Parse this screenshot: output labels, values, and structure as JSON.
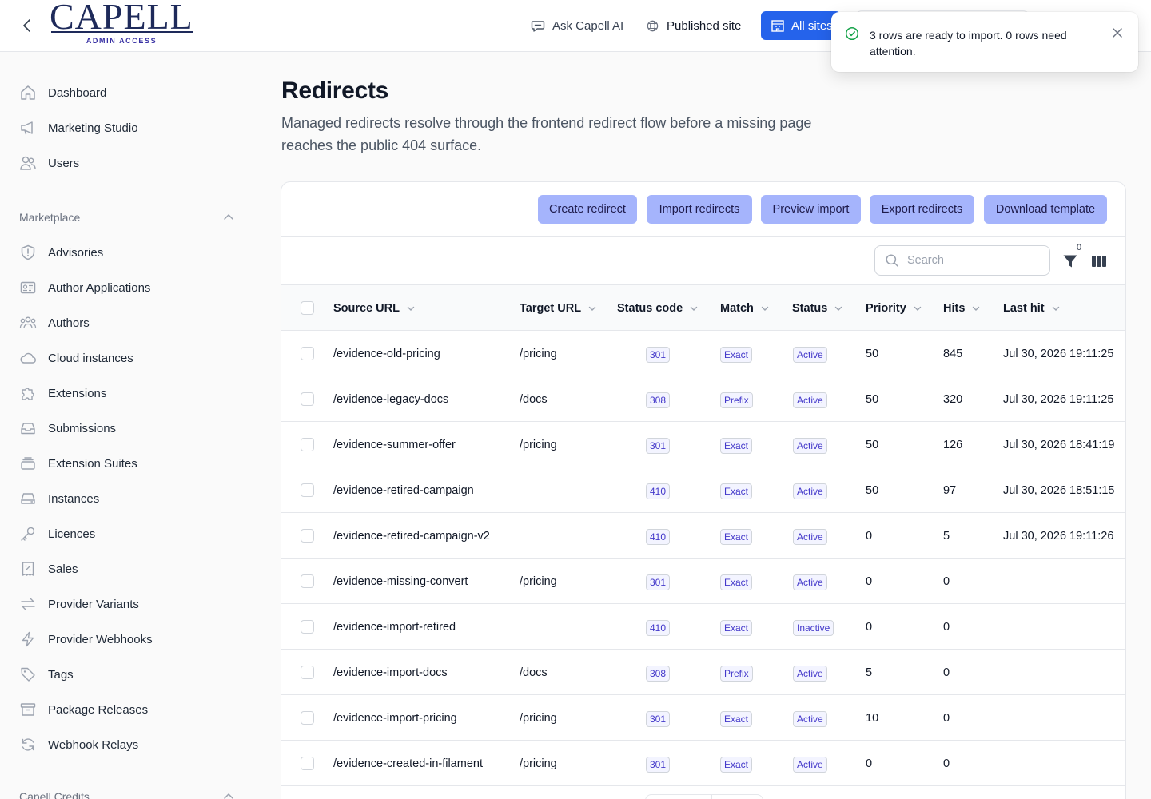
{
  "brand": {
    "name": "CAPELL",
    "subtitle": "ADMIN ACCESS"
  },
  "topbar": {
    "ask_ai": "Ask Capell AI",
    "published_site": "Published site",
    "all_sites": "All sites"
  },
  "toast": {
    "message": "3 rows are ready to import. 0 rows need attention."
  },
  "sidebar": {
    "primary": [
      {
        "label": "Dashboard",
        "icon": "home-icon"
      },
      {
        "label": "Marketing Studio",
        "icon": "megaphone-icon"
      },
      {
        "label": "Users",
        "icon": "users-icon"
      }
    ],
    "marketplace_label": "Marketplace",
    "marketplace": [
      {
        "label": "Advisories",
        "icon": "shield-icon"
      },
      {
        "label": "Author Applications",
        "icon": "id-card-icon"
      },
      {
        "label": "Authors",
        "icon": "user-group-icon"
      },
      {
        "label": "Cloud instances",
        "icon": "cloud-icon"
      },
      {
        "label": "Extensions",
        "icon": "puzzle-icon"
      },
      {
        "label": "Submissions",
        "icon": "inbox-icon"
      },
      {
        "label": "Extension Suites",
        "icon": "stack-icon"
      },
      {
        "label": "Instances",
        "icon": "server-icon"
      },
      {
        "label": "Licences",
        "icon": "key-icon"
      },
      {
        "label": "Sales",
        "icon": "receipt-icon"
      },
      {
        "label": "Provider Variants",
        "icon": "arrows-icon"
      },
      {
        "label": "Provider Webhooks",
        "icon": "bolt-icon"
      },
      {
        "label": "Tags",
        "icon": "tag-icon"
      },
      {
        "label": "Package Releases",
        "icon": "archive-icon"
      },
      {
        "label": "Webhook Relays",
        "icon": "refresh-icon"
      }
    ],
    "credits_label": "Capell Credits"
  },
  "page": {
    "title": "Redirects",
    "description": "Managed redirects resolve through the frontend redirect flow before a missing page reaches the public 404 surface."
  },
  "actions": {
    "create": "Create redirect",
    "import": "Import redirects",
    "preview": "Preview import",
    "export": "Export redirects",
    "template": "Download template"
  },
  "toolbar": {
    "search_placeholder": "Search",
    "filter_count": "0"
  },
  "table": {
    "columns": [
      "Source URL",
      "Target URL",
      "Status code",
      "Match",
      "Status",
      "Priority",
      "Hits",
      "Last hit"
    ],
    "rows": [
      {
        "source": "/evidence-old-pricing",
        "target": "/pricing",
        "code": "301",
        "match": "Exact",
        "status": "Active",
        "priority": "50",
        "hits": "845",
        "last_hit": "Jul 30, 2026 19:11:25"
      },
      {
        "source": "/evidence-legacy-docs",
        "target": "/docs",
        "code": "308",
        "match": "Prefix",
        "status": "Active",
        "priority": "50",
        "hits": "320",
        "last_hit": "Jul 30, 2026 19:11:25"
      },
      {
        "source": "/evidence-summer-offer",
        "target": "/pricing",
        "code": "301",
        "match": "Exact",
        "status": "Active",
        "priority": "50",
        "hits": "126",
        "last_hit": "Jul 30, 2026 18:41:19"
      },
      {
        "source": "/evidence-retired-campaign",
        "target": "",
        "code": "410",
        "match": "Exact",
        "status": "Active",
        "priority": "50",
        "hits": "97",
        "last_hit": "Jul 30, 2026 18:51:15"
      },
      {
        "source": "/evidence-retired-campaign-v2",
        "target": "",
        "code": "410",
        "match": "Exact",
        "status": "Active",
        "priority": "0",
        "hits": "5",
        "last_hit": "Jul 30, 2026 19:11:26"
      },
      {
        "source": "/evidence-missing-convert",
        "target": "/pricing",
        "code": "301",
        "match": "Exact",
        "status": "Active",
        "priority": "0",
        "hits": "0",
        "last_hit": ""
      },
      {
        "source": "/evidence-import-retired",
        "target": "",
        "code": "410",
        "match": "Exact",
        "status": "Inactive",
        "priority": "0",
        "hits": "0",
        "last_hit": ""
      },
      {
        "source": "/evidence-import-docs",
        "target": "/docs",
        "code": "308",
        "match": "Prefix",
        "status": "Active",
        "priority": "5",
        "hits": "0",
        "last_hit": ""
      },
      {
        "source": "/evidence-import-pricing",
        "target": "/pricing",
        "code": "301",
        "match": "Exact",
        "status": "Active",
        "priority": "10",
        "hits": "0",
        "last_hit": ""
      },
      {
        "source": "/evidence-created-in-filament",
        "target": "/pricing",
        "code": "301",
        "match": "Exact",
        "status": "Active",
        "priority": "0",
        "hits": "0",
        "last_hit": ""
      }
    ]
  },
  "colors": {
    "accent": "#2563eb",
    "action_button": "#a5b4fc",
    "success": "#16a34a"
  }
}
